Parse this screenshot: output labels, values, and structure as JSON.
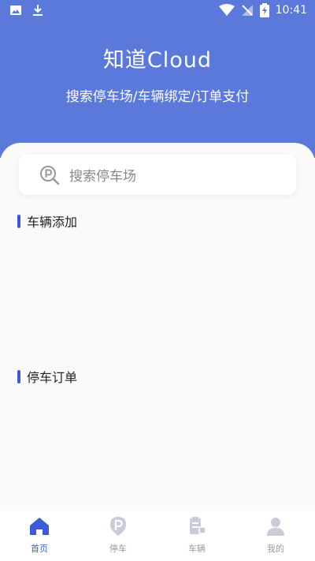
{
  "status_bar": {
    "time": "10:41"
  },
  "header": {
    "title": "知道Cloud",
    "subtitle": "搜索停车场/车辆绑定/订单支付"
  },
  "search": {
    "placeholder": "搜索停车场"
  },
  "sections": [
    {
      "title": "车辆添加"
    },
    {
      "title": "停车订单"
    }
  ],
  "tabs": [
    {
      "label": "首页",
      "icon": "home-icon",
      "active": true
    },
    {
      "label": "停车",
      "icon": "parking-icon",
      "active": false
    },
    {
      "label": "车辆",
      "icon": "vehicle-icon",
      "active": false
    },
    {
      "label": "我的",
      "icon": "profile-icon",
      "active": false
    }
  ],
  "colors": {
    "header_bg": "#5b79db",
    "accent": "#3b5bd9",
    "inactive_icon": "#c9ccd6"
  }
}
